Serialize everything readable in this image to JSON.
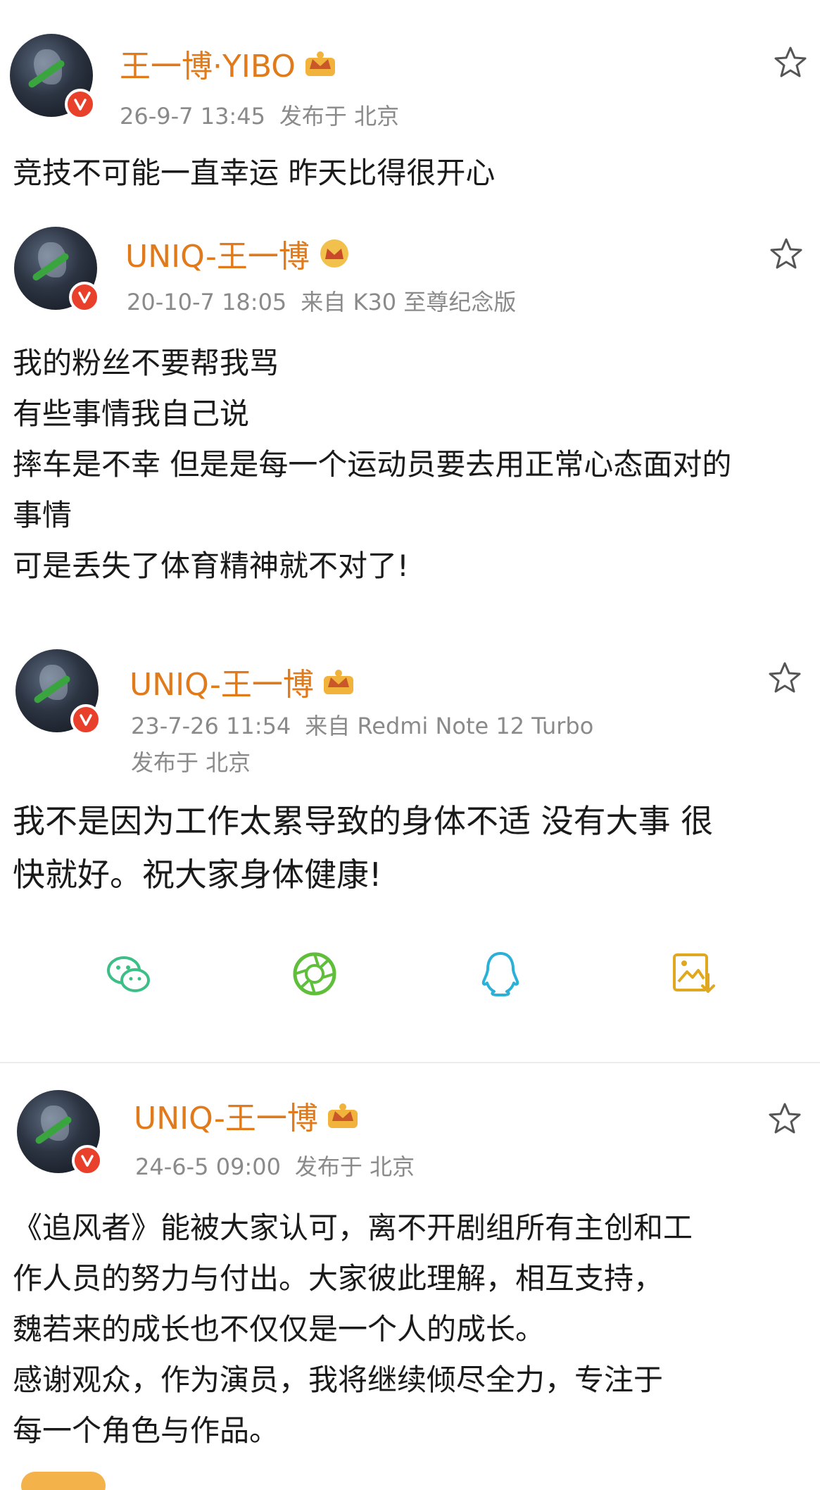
{
  "posts": [
    {
      "username": "王一博·YIBO",
      "date": "26-9-7 13:45",
      "source": "发布于 北京",
      "lines": [
        "竞技不可能一直幸运 昨天比得很开心"
      ]
    },
    {
      "username": "UNIQ-王一博",
      "date": "20-10-7 18:05",
      "source": "来自 K30 至尊纪念版",
      "lines": [
        "我的粉丝不要帮我骂",
        "有些事情我自己说",
        "摔车是不幸 但是是每一个运动员要去用正常心态面对的",
        "事情",
        "可是丢失了体育精神就不对了!"
      ]
    },
    {
      "username": "UNIQ-王一博",
      "date": "23-7-26 11:54",
      "source": "来自 Redmi Note 12 Turbo",
      "location": "发布于 北京",
      "lines": [
        "我不是因为工作太累导致的身体不适 没有大事 很",
        "快就好。祝大家身体健康!"
      ]
    },
    {
      "username": "UNIQ-王一博",
      "date": "24-6-5 09:00",
      "source": "发布于 北京",
      "lines": [
        "《追风者》能被大家认可，离不开剧组所有主创和工",
        "作人员的努力与付出。大家彼此理解，相互支持，",
        "魏若来的成长也不仅仅是一个人的成长。",
        "感谢观众，作为演员，我将继续倾尽全力，专注于",
        "每一个角色与作品。"
      ]
    }
  ],
  "share": {
    "icons": [
      "wechat-icon",
      "moments-icon",
      "qq-icon",
      "save-image-icon"
    ]
  },
  "colors": {
    "username": "#e07a1a",
    "meta": "#8a8a8a",
    "verified": "#e8402a",
    "wechat": "#3cbf86",
    "moments": "#5fbf3a",
    "qq": "#2bb0d8",
    "save": "#e0a820"
  }
}
